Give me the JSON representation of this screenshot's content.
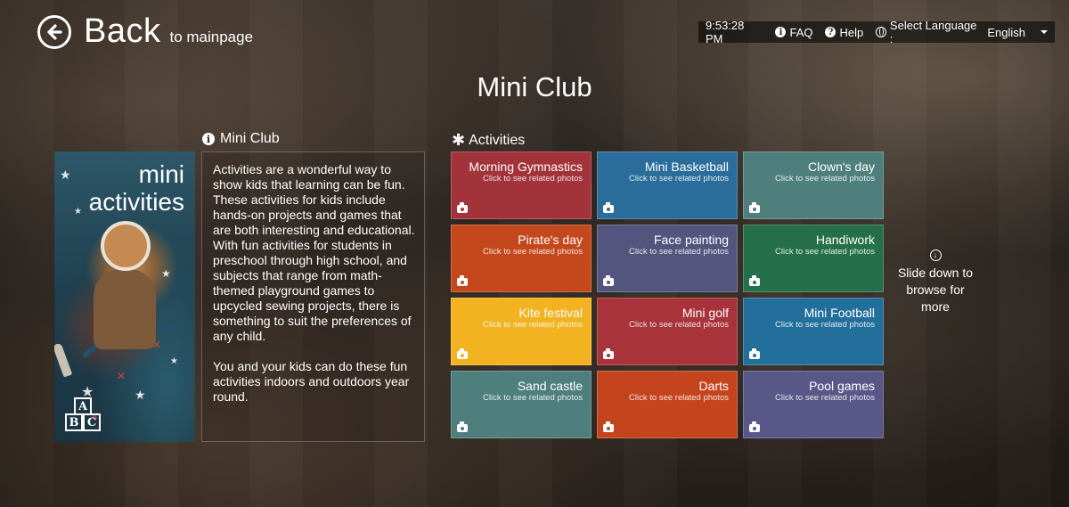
{
  "header": {
    "back_label": "Back",
    "back_sub": "to mainpage"
  },
  "topbar": {
    "time": "9:53:28 PM",
    "faq": "FAQ",
    "help": "Help",
    "language_label": "Select Language :",
    "language_value": "English"
  },
  "page": {
    "title": "Mini Club"
  },
  "promo": {
    "title_line1": "mini",
    "title_line2": "activities",
    "block_a": "A",
    "block_b": "B",
    "block_c": "C"
  },
  "description": {
    "heading": "Mini Club",
    "paragraph1": "Activities are a wonderful way to show kids that learning can be fun. These activities for kids include hands-on projects and games that are both interesting and educational. With fun activities for students in preschool through high school, and subjects that range from math-themed playground games to upcycled sewing projects, there is something to suit the preferences of any child.",
    "paragraph2": "You and your kids can do these fun activities indoors and outdoors year round."
  },
  "activities": {
    "heading": "Activities",
    "tile_subtitle": "Click to see related photos",
    "items": [
      {
        "name": "Morning Gymnastics",
        "color": "#a3333a"
      },
      {
        "name": "Mini Basketball",
        "color": "#2a6d9a"
      },
      {
        "name": "Clown's day",
        "color": "#4f7f7d"
      },
      {
        "name": "Pirate's day",
        "color": "#c4481c"
      },
      {
        "name": "Face painting",
        "color": "#54557e"
      },
      {
        "name": "Handiwork",
        "color": "#25704a"
      },
      {
        "name": "Kite festival",
        "color": "#f3b21f"
      },
      {
        "name": "Mini golf",
        "color": "#a8333a"
      },
      {
        "name": "Mini Football",
        "color": "#236f9c"
      },
      {
        "name": "Sand castle",
        "color": "#4e7f7d"
      },
      {
        "name": "Darts",
        "color": "#c4451d"
      },
      {
        "name": "Pool games",
        "color": "#595788"
      }
    ]
  },
  "slide_hint": {
    "line1": "Slide down to",
    "line2": "browse for",
    "line3": "more"
  }
}
